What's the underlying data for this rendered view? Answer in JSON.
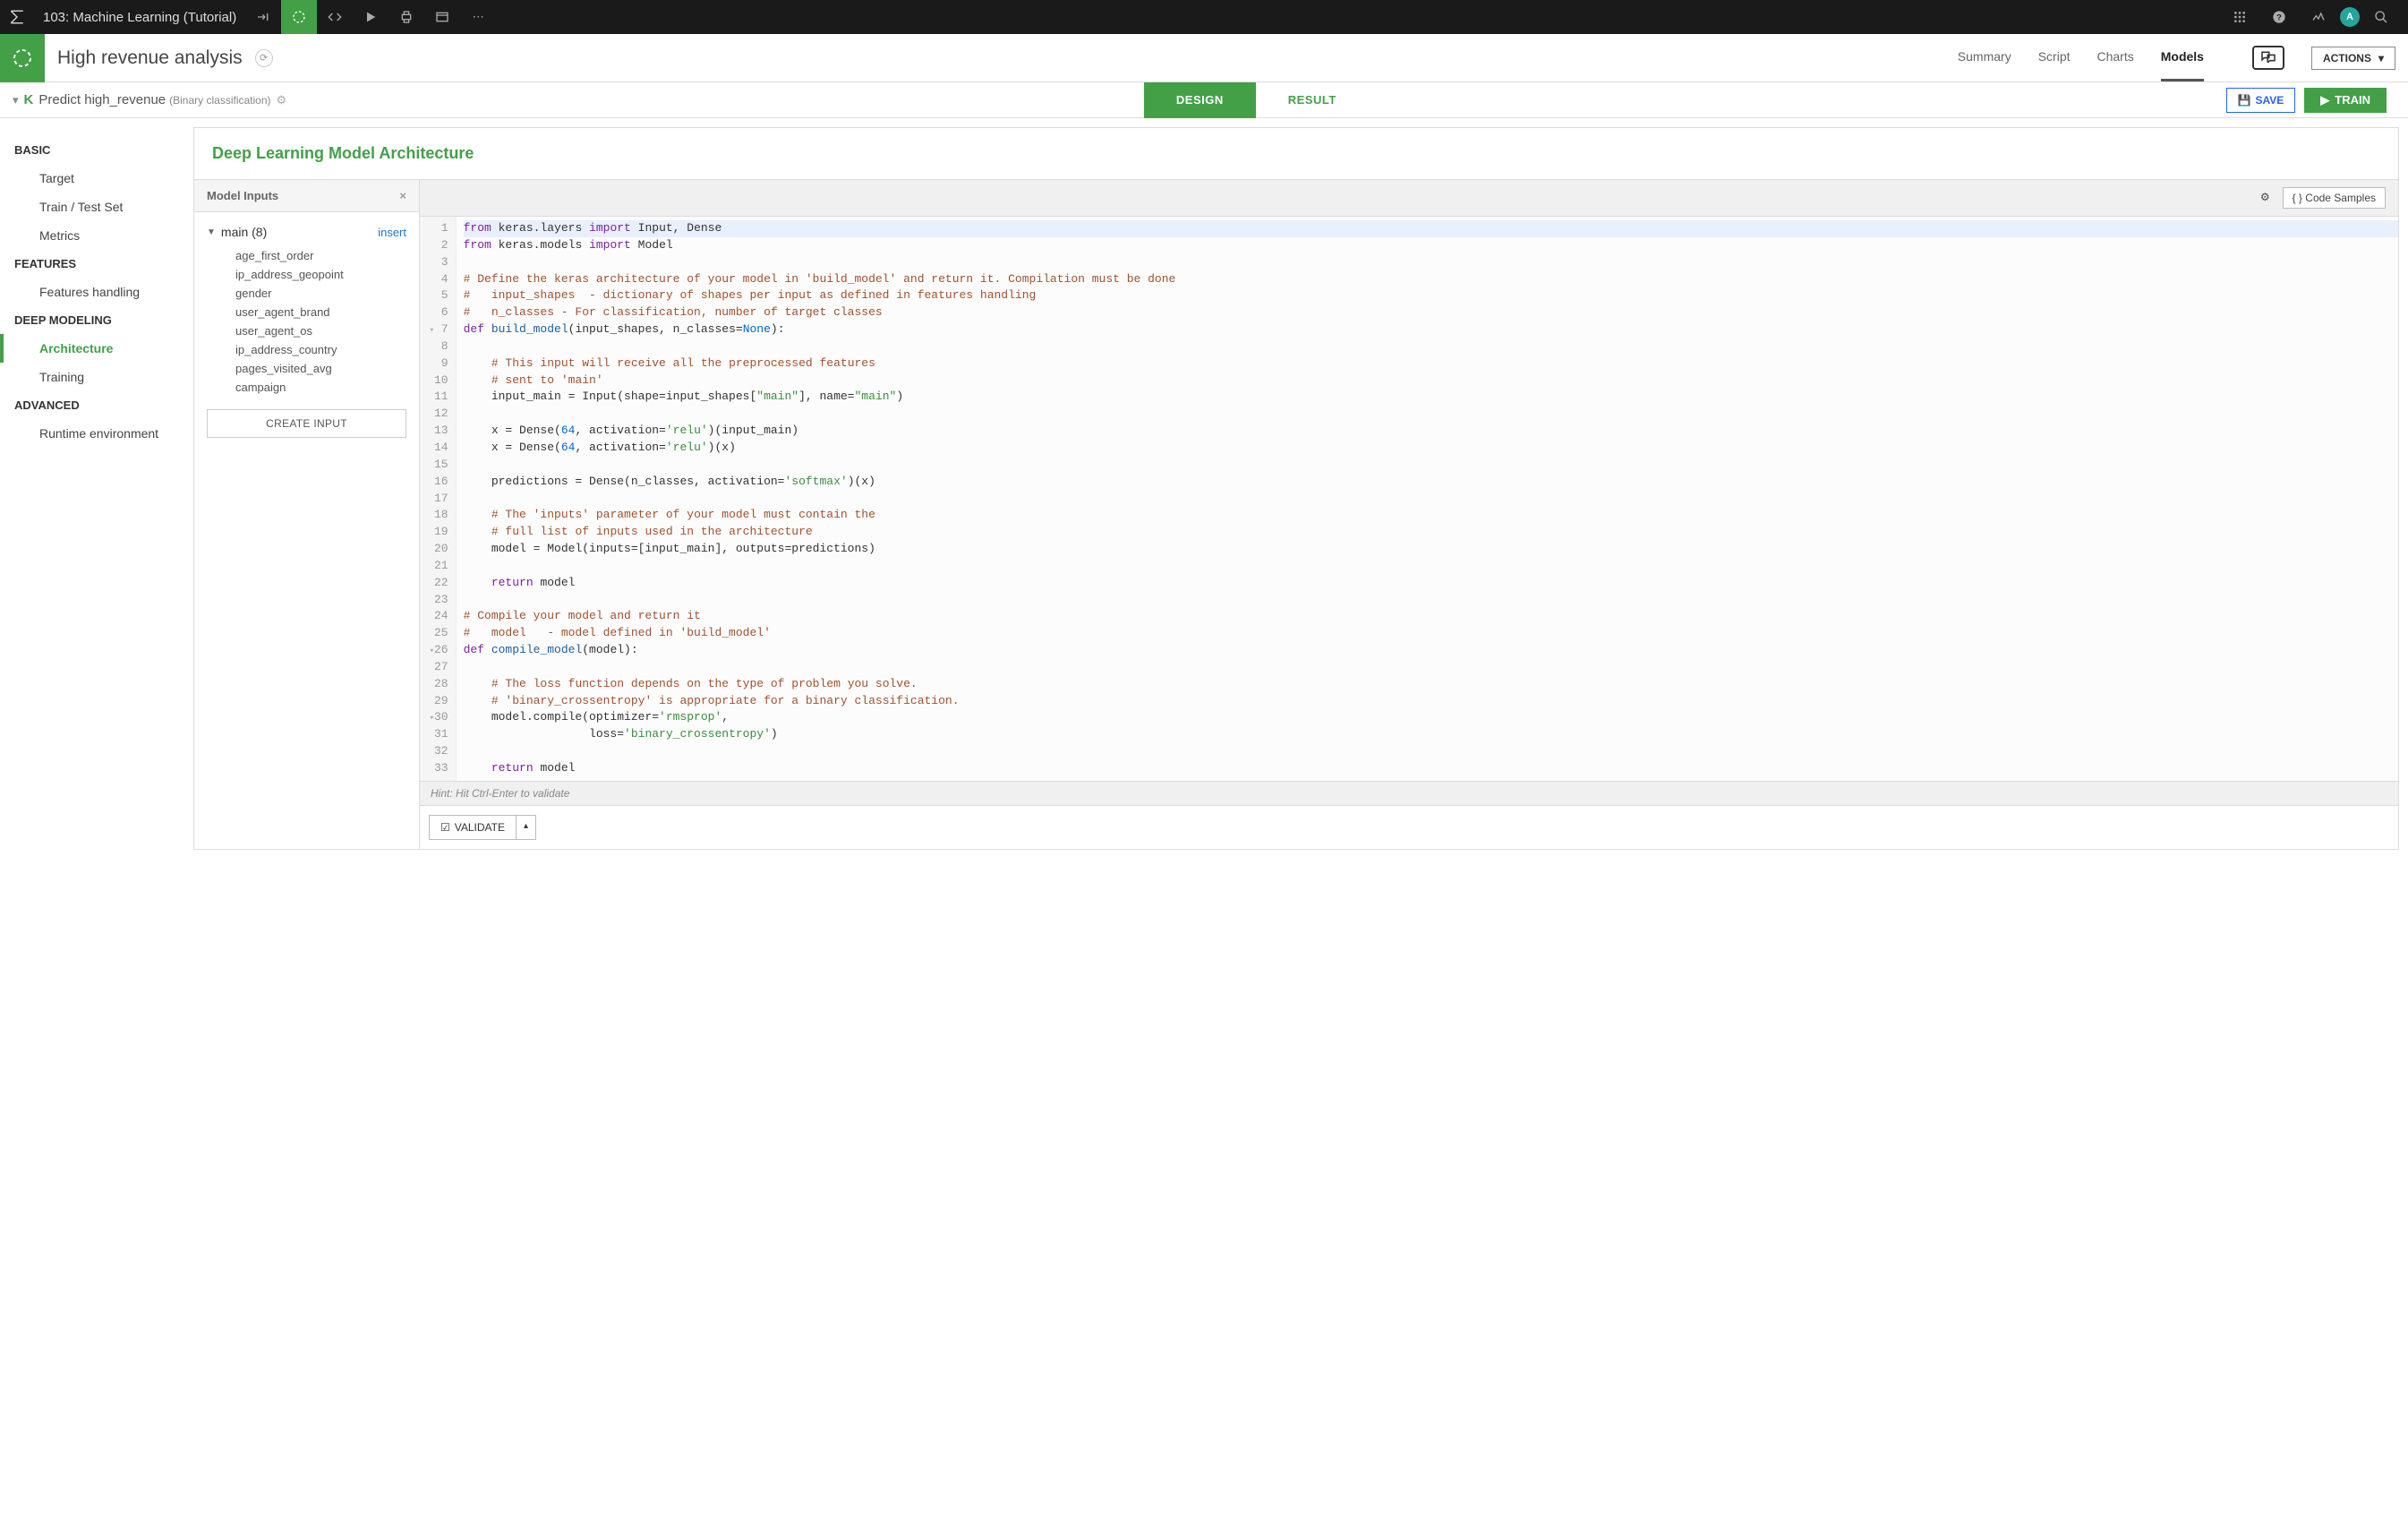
{
  "topbar": {
    "project_name": "103: Machine Learning (Tutorial)",
    "avatar_letter": "A"
  },
  "header2": {
    "title": "High revenue analysis",
    "tabs": [
      "Summary",
      "Script",
      "Charts",
      "Models"
    ],
    "active_tab": "Models",
    "actions_label": "ACTIONS"
  },
  "breadcrumb": {
    "icon_letter": "K",
    "name": "Predict high_revenue",
    "subtitle": "(Binary classification)",
    "design_label": "DESIGN",
    "result_label": "RESULT",
    "save_label": "SAVE",
    "train_label": "TRAIN"
  },
  "sidebar": {
    "sec_basic": "BASIC",
    "basic_items": [
      "Target",
      "Train / Test Set",
      "Metrics"
    ],
    "sec_features": "FEATURES",
    "features_items": [
      "Features handling"
    ],
    "sec_deep": "DEEP MODELING",
    "deep_items": [
      "Architecture",
      "Training"
    ],
    "active_deep": "Architecture",
    "sec_advanced": "ADVANCED",
    "advanced_items": [
      "Runtime environment"
    ]
  },
  "panel": {
    "title": "Deep Learning Model Architecture",
    "inputs_title": "Model Inputs",
    "group_label": "main (8)",
    "insert_label": "insert",
    "input_features": [
      "age_first_order",
      "ip_address_geopoint",
      "gender",
      "user_agent_brand",
      "user_agent_os",
      "ip_address_country",
      "pages_visited_avg",
      "campaign"
    ],
    "create_input_label": "CREATE INPUT",
    "code_samples_label": "{ } Code Samples",
    "hint": "Hint: Hit Ctrl-Enter to validate",
    "validate_label": "VALIDATE"
  },
  "code": {
    "line_count": 33,
    "fold_lines": [
      7,
      26,
      30
    ]
  }
}
